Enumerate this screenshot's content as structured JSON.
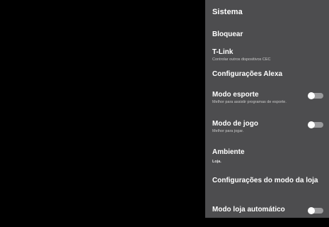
{
  "panel": {
    "title": "Sistema",
    "items": [
      {
        "label": "Bloquear"
      },
      {
        "label": "T-Link",
        "sub": "Controlar outros dispositivos CEC"
      },
      {
        "label": "Configurações Alexa"
      },
      {
        "label": "Modo esporte",
        "sub": "Melhor para assistir programas de esporte.",
        "toggle": false
      },
      {
        "label": "Modo de jogo",
        "sub": "Melhor para jogar.",
        "toggle": false
      },
      {
        "label": "Ambiente",
        "sub": "Loja."
      },
      {
        "label": "Configurações do modo da loja"
      },
      {
        "label": "Modo loja automático",
        "toggle": false
      }
    ]
  },
  "colors": {
    "panel_bg": "#4d4d4f",
    "screen_bg": "#000000",
    "toggle_track": "#9a9a9c",
    "toggle_knob": "#ffffff"
  }
}
